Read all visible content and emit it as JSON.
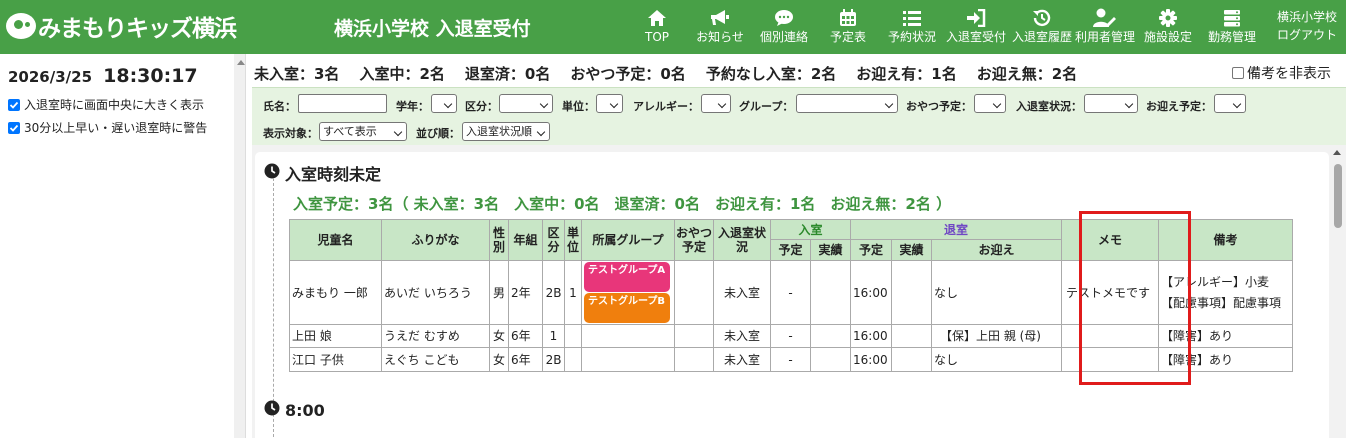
{
  "header": {
    "logo_text": "みまもりキッズ横浜",
    "school_title": "横浜小学校 入退室受付",
    "nav": [
      {
        "label": "TOP",
        "icon": "home-icon"
      },
      {
        "label": "お知らせ",
        "icon": "megaphone-icon"
      },
      {
        "label": "個別連絡",
        "icon": "chat-icon"
      },
      {
        "label": "予定表",
        "icon": "calendar-icon"
      },
      {
        "label": "予約状況",
        "icon": "list-icon"
      },
      {
        "label": "入退室受付",
        "icon": "sign-in-icon"
      },
      {
        "label": "入退室履歴",
        "icon": "history-icon"
      },
      {
        "label": "利用者管理",
        "icon": "user-edit-icon"
      },
      {
        "label": "施設設定",
        "icon": "gear-icon"
      },
      {
        "label": "勤務管理",
        "icon": "server-icon"
      }
    ],
    "user_name": "横浜小学校",
    "logout_label": "ログアウト"
  },
  "left": {
    "date": "2026/3/25",
    "time": "18:30:17",
    "options": [
      {
        "label": "入退室時に画面中央に大きく表示",
        "checked": true
      },
      {
        "label": "30分以上早い・遅い退室時に警告",
        "checked": true
      }
    ]
  },
  "summary": {
    "items": [
      "未入室：3名",
      "入室中：2名",
      "退室済：0名",
      "おやつ予定：0名",
      "予約なし入室：2名",
      "お迎え有：1名",
      "お迎え無：2名"
    ],
    "hide_notes_label": "備考を非表示"
  },
  "filters": {
    "name_label": "氏名：",
    "grade_label": "学年：",
    "section_label": "区分：",
    "unit_label": "単位：",
    "allergy_label": "アレルギー：",
    "group_label": "グループ：",
    "snack_label": "おやつ予定：",
    "status_label": "入退室状況：",
    "pickup_label": "お迎え予定：",
    "display_label": "表示対象：",
    "display_value": "すべて表示",
    "order_label": "並び順：",
    "order_value": "入退室状況順"
  },
  "sections": [
    {
      "title": "入室時刻未定",
      "summary": "入室予定：3名（ 未入室：3名　入室中：0名　退室済：0名　お迎え有：1名　お迎え無：2名 ）"
    },
    {
      "title": "8:00"
    }
  ],
  "table": {
    "headers": {
      "name": "児童名",
      "kana": "ふりがな",
      "gender": "性別",
      "grade": "年組",
      "section": "区分",
      "unit": "単位",
      "group": "所属グループ",
      "snack": "おやつ予定",
      "status": "入退室状況",
      "entry": "入室",
      "exit": "退室",
      "planned": "予定",
      "actual": "実績",
      "pickup": "お迎え",
      "memo": "メモ",
      "notes": "備考"
    },
    "rows": [
      {
        "name": "みまもり 一郎",
        "kana": "あいだ いちろう",
        "gender": "男",
        "grade": "2年",
        "section": "2B",
        "unit": "1",
        "groups": [
          {
            "label": "テストグループA",
            "color": "#e8367a"
          },
          {
            "label": "テストグループB",
            "color": "#f07f0d"
          }
        ],
        "snack": "",
        "status": "未入室",
        "entry_plan": "-",
        "entry_actual": "",
        "exit_plan": "16:00",
        "exit_actual": "",
        "pickup": "なし",
        "memo": "テストメモです",
        "notes": "【アレルギー】小麦【配慮事項】配慮事項"
      },
      {
        "name": "上田 娘",
        "kana": "うえだ むすめ",
        "gender": "女",
        "grade": "6年",
        "section": "1",
        "unit": "",
        "groups": [],
        "snack": "",
        "status": "未入室",
        "entry_plan": "-",
        "entry_actual": "",
        "exit_plan": "16:00",
        "exit_actual": "",
        "pickup": "【保】上田 親 (母)",
        "memo": "",
        "notes": "【障害】あり"
      },
      {
        "name": "江口 子供",
        "kana": "えぐち こども",
        "gender": "女",
        "grade": "6年",
        "section": "2B",
        "unit": "",
        "groups": [],
        "snack": "",
        "status": "未入室",
        "entry_plan": "-",
        "entry_actual": "",
        "exit_plan": "16:00",
        "exit_actual": "",
        "pickup": "なし",
        "memo": "",
        "notes": "【障害】あり"
      }
    ]
  },
  "colors": {
    "header_green": "#48a047",
    "table_header": "#c8e6c6",
    "filter_bg": "#e6f3e1",
    "section_summary": "#3f9540",
    "highlight": "#e01b1b"
  }
}
